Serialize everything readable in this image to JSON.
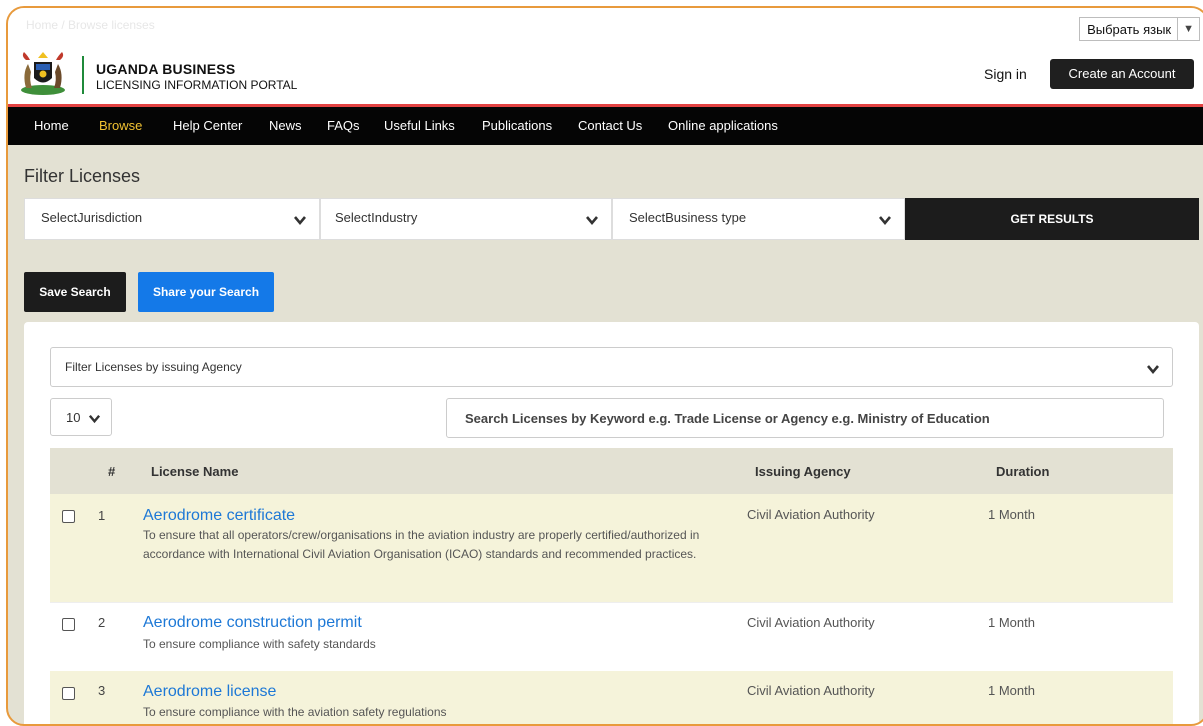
{
  "translate_bar": {
    "breadcrumb": "Home / Browse licenses",
    "language_label": "Выбрать язык"
  },
  "header": {
    "brand_title": "UGANDA BUSINESS",
    "brand_subtitle": "LICENSING INFORMATION PORTAL",
    "sign_in": "Sign in",
    "create_account": "Create an Account"
  },
  "nav": {
    "items": [
      "Home",
      "Browse",
      "Help Center",
      "News",
      "FAQs",
      "Useful Links",
      "Publications",
      "Contact Us",
      "Online applications"
    ],
    "active": "Browse"
  },
  "filter": {
    "title": "Filter Licenses",
    "jurisdiction": "SelectJurisdiction",
    "industry": "SelectIndustry",
    "business_type": "SelectBusiness type",
    "get_results": "GET RESULTS"
  },
  "actions": {
    "save_search": "Save Search",
    "share_search": "Share your Search"
  },
  "list": {
    "agency_filter": "Filter Licenses by issuing Agency",
    "page_size": "10",
    "keyword_placeholder": "Search Licenses by Keyword e.g. Trade License or Agency e.g. Ministry of Education",
    "columns": {
      "num": "#",
      "name": "License Name",
      "agency": "Issuing Agency",
      "duration": "Duration"
    },
    "rows": [
      {
        "num": "1",
        "name": "Aerodrome certificate",
        "description": "To ensure that all operators/crew/organisations in the aviation industry are properly certified/authorized in accordance with International Civil Aviation Organisation (ICAO) standards and recommended practices.",
        "agency": "Civil Aviation Authority",
        "duration": "1 Month"
      },
      {
        "num": "2",
        "name": "Aerodrome construction permit",
        "description": "To ensure compliance with safety standards",
        "agency": "Civil Aviation Authority",
        "duration": "1 Month"
      },
      {
        "num": "3",
        "name": "Aerodrome license",
        "description": "To ensure compliance with the aviation safety regulations",
        "agency": "Civil Aviation Authority",
        "duration": "1 Month"
      }
    ]
  },
  "colors": {
    "accent_orange": "#e89a3c",
    "nav_bg": "#050505",
    "nav_active": "#f1c232",
    "link_blue": "#1d78d6",
    "share_blue": "#1479e8",
    "header_rule": "#e34242"
  }
}
